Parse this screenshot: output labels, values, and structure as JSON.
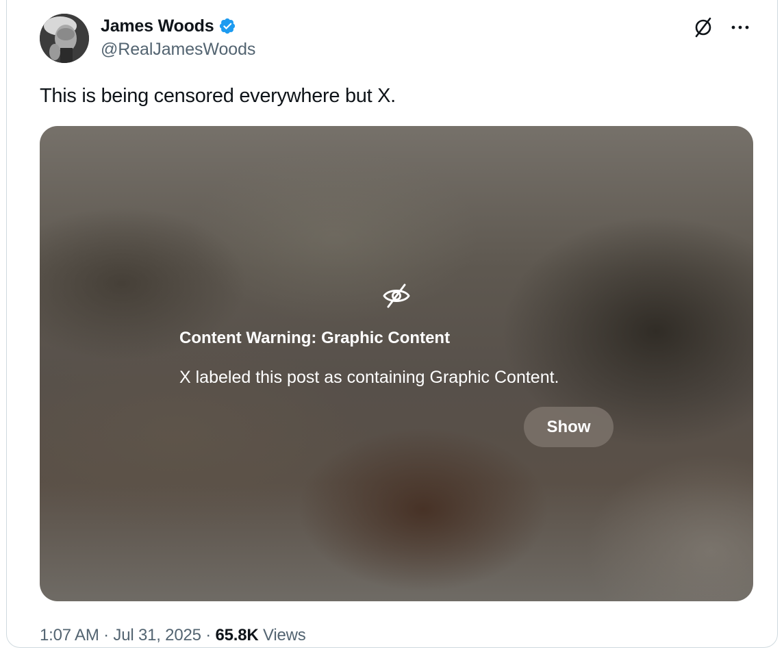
{
  "author": {
    "display_name": "James Woods",
    "handle": "@RealJamesWoods",
    "verified_icon": "verified-badge-icon",
    "badge_color": "#1d9bf0"
  },
  "actions": {
    "grok_icon": "grok-icon",
    "more_icon": "more-horizontal-icon"
  },
  "post": {
    "text": "This is being censored everywhere but X."
  },
  "media_warning": {
    "icon": "eye-slash-icon",
    "title": "Content Warning: Graphic Content",
    "description": "X labeled this post as containing Graphic Content.",
    "show_label": "Show"
  },
  "meta": {
    "time": "1:07 AM",
    "separator": " · ",
    "date": "Jul 31, 2025",
    "views_count": "65.8K",
    "views_label": "Views"
  },
  "colors": {
    "text_primary": "#0f1419",
    "text_secondary": "#536471",
    "border": "#cfd9de"
  }
}
